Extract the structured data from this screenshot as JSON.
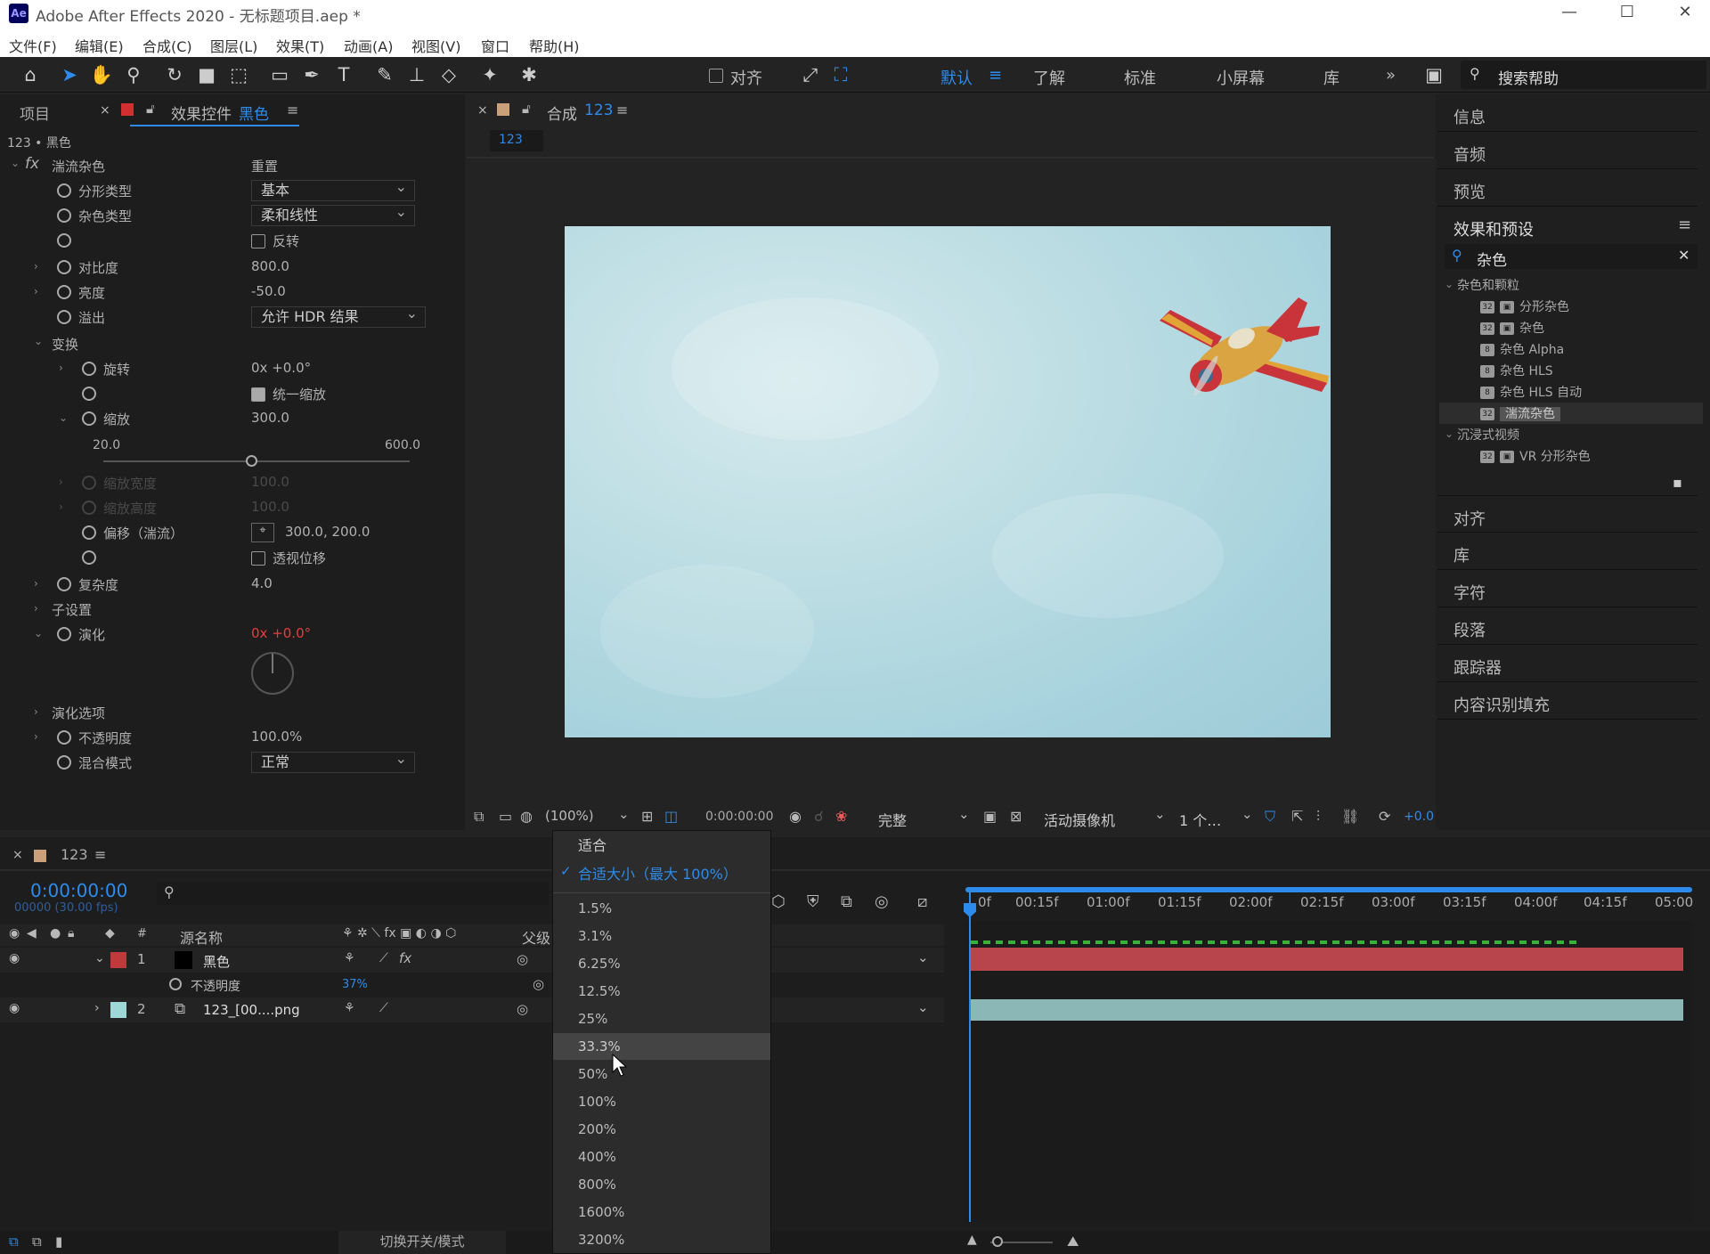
{
  "window": {
    "app_title": "Adobe After Effects 2020 - 无标题项目.aep *",
    "logo": "Ae",
    "minimize": "—",
    "maximize": "☐",
    "close": "✕"
  },
  "menu": [
    "文件(F)",
    "编辑(E)",
    "合成(C)",
    "图层(L)",
    "效果(T)",
    "动画(A)",
    "视图(V)",
    "窗口",
    "帮助(H)"
  ],
  "toolbar": {
    "align_label": "对齐",
    "workspaces": [
      "默认",
      "了解",
      "标准",
      "小屏幕",
      "库"
    ],
    "search_label": "搜索帮助",
    "more": "»"
  },
  "left_panel": {
    "tab_project": "项目",
    "tab_effects_prefix": "效果控件",
    "tab_effects_layer": "黑色",
    "breadcrumb": "123 • 黑色",
    "effect_name": "湍流杂色",
    "reset": "重置",
    "props": {
      "fractal_type": "分形类型",
      "fractal_value": "基本",
      "noise_type": "杂色类型",
      "noise_value": "柔和线性",
      "invert": "反转",
      "contrast": "对比度",
      "contrast_value": "800.0",
      "brightness": "亮度",
      "brightness_value": "-50.0",
      "overflow": "溢出",
      "overflow_value": "允许 HDR 结果",
      "transform": "变换",
      "rotation": "旋转",
      "rotation_value": "0x +0.0°",
      "uniform_scale": "统一缩放",
      "scale": "缩放",
      "scale_value": "300.0",
      "slider_min": "20.0",
      "slider_max": "600.0",
      "scale_width": "缩放宽度",
      "scale_width_value": "100.0",
      "scale_height": "缩放高度",
      "scale_height_value": "100.0",
      "offset": "偏移（湍流）",
      "offset_value": "300.0, 200.0",
      "perspective": "透视位移",
      "complexity": "复杂度",
      "complexity_value": "4.0",
      "sub_settings": "子设置",
      "evolution": "演化",
      "evolution_value": "0x +0.0°",
      "evolution_options": "演化选项",
      "opacity": "不透明度",
      "opacity_value": "100.0%",
      "blend_mode": "混合模式",
      "blend_value": "正常"
    }
  },
  "comp_panel": {
    "tab_prefix": "合成",
    "tab_name": "123",
    "sub_tab": "123",
    "bottom": {
      "zoom": "(100%)",
      "timecode": "0:00:00:00",
      "quality": "完整",
      "camera": "活动摄像机",
      "views": "1 个…",
      "exposure": "+0.0"
    }
  },
  "right_panel": {
    "panels_top": [
      "信息",
      "音频",
      "预览"
    ],
    "effects_presets": "效果和预设",
    "search_value": "杂色",
    "groups": [
      {
        "name": "杂色和颗粒",
        "items": [
          {
            "badge": "32",
            "label": "分形杂色"
          },
          {
            "badge": "32",
            "label": "杂色"
          },
          {
            "badge": "8",
            "label": "杂色 Alpha"
          },
          {
            "badge": "8",
            "label": "杂色 HLS"
          },
          {
            "badge": "8",
            "label": "杂色 HLS 自动"
          },
          {
            "badge": "32",
            "label": "湍流杂色"
          }
        ]
      },
      {
        "name": "沉浸式视频",
        "items": [
          {
            "badge": "32",
            "label": "VR 分形杂色"
          }
        ]
      }
    ],
    "panels_bottom": [
      "对齐",
      "库",
      "字符",
      "段落",
      "跟踪器",
      "内容识别填充"
    ]
  },
  "timeline": {
    "tab": "123",
    "timecode": "0:00:00:00",
    "frames": "00000 (30.00 fps)",
    "col_source": "源名称",
    "col_parent": "父级",
    "col_num": "#",
    "layers": [
      {
        "num": "1",
        "name": "黑色",
        "color": "#c0393b",
        "swatch": "#000000"
      },
      {
        "num": "2",
        "name": "123_[00....png",
        "color": "#9fd6d6",
        "swatch": "#9fd6d6"
      }
    ],
    "sub_prop": "不透明度",
    "sub_value": "37%",
    "toggle_label": "切换开关/模式",
    "ruler": [
      "0f",
      "00:15f",
      "01:00f",
      "01:15f",
      "02:00f",
      "02:15f",
      "03:00f",
      "03:15f",
      "04:00f",
      "04:15f",
      "05:00"
    ]
  },
  "zoom_menu": {
    "items": [
      "适合",
      "合适大小（最大 100%）",
      "1.5%",
      "3.1%",
      "6.25%",
      "12.5%",
      "25%",
      "33.3%",
      "50%",
      "100%",
      "200%",
      "400%",
      "800%",
      "1600%",
      "3200%"
    ],
    "checked": "合适大小（最大 100%）",
    "hovered": "33.3%"
  },
  "colors": {
    "accent": "#2d8ceb",
    "layer_red": "#c0393b",
    "layer_teal": "#9fd6d6",
    "sky": "#b9dbe2"
  }
}
